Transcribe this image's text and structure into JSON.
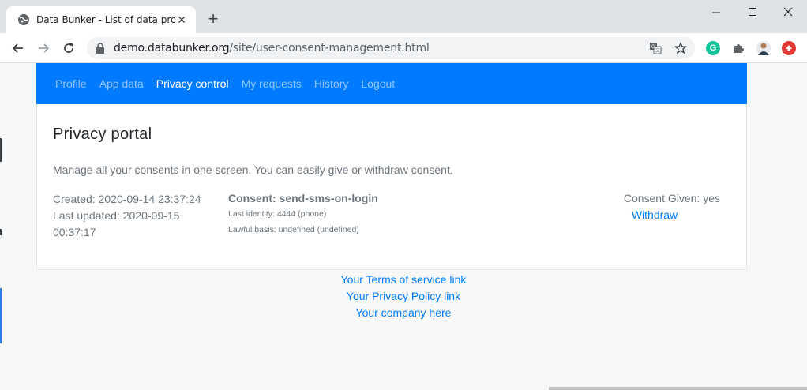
{
  "browser": {
    "tab_title": "Data Bunker - List of data proces",
    "url_domain": "demo.databunker.org",
    "url_path": "/site/user-consent-management.html"
  },
  "nav": {
    "items": [
      {
        "label": "Profile",
        "active": false
      },
      {
        "label": "App data",
        "active": false
      },
      {
        "label": "Privacy control",
        "active": true
      },
      {
        "label": "My requests",
        "active": false
      },
      {
        "label": "History",
        "active": false
      },
      {
        "label": "Logout",
        "active": false
      }
    ]
  },
  "portal": {
    "title": "Privacy portal",
    "lead": "Manage all your consents in one screen. You can easily give or withdraw consent."
  },
  "consent": {
    "created": "Created: 2020-09-14 23:37:24",
    "updated_line1": "Last updated: 2020-09-15",
    "updated_line2": "00:37:17",
    "name": "Consent: send-sms-on-login",
    "identity": "Last identity: 4444 (phone)",
    "lawful_basis": "Lawful basis: undefined (undefined)",
    "status": "Consent Given: yes",
    "withdraw_label": "Withdraw"
  },
  "footer": {
    "terms": "Your Terms of service link",
    "privacy": "Your Privacy Policy link",
    "company": "Your company here"
  },
  "colors": {
    "primary": "#007bff",
    "muted": "#6c757d"
  }
}
